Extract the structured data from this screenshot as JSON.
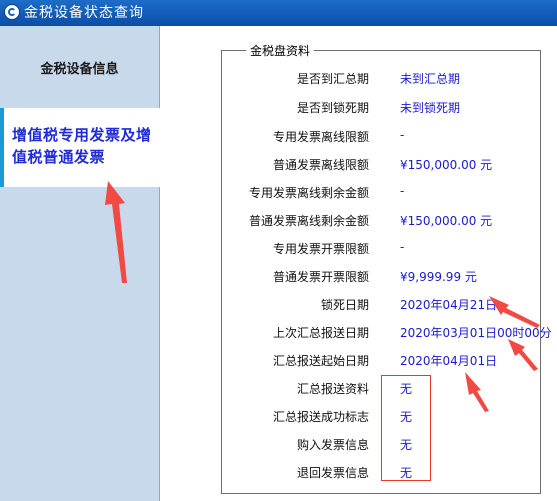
{
  "window": {
    "title": "金税设备状态查询",
    "icon": "golden-tax-app-icon"
  },
  "sidebar": {
    "tabs": [
      {
        "label": "金税设备信息"
      },
      {
        "label_line1": "增值税专用发票及增",
        "label_line2": "值税普通发票"
      }
    ]
  },
  "group": {
    "legend": "金税盘资料",
    "rows": [
      {
        "label": "是否到汇总期",
        "value": "未到汇总期"
      },
      {
        "label": "是否到锁死期",
        "value": "未到锁死期"
      },
      {
        "label": "专用发票离线限额",
        "value": "-"
      },
      {
        "label": "普通发票离线限额",
        "value": "¥150,000.00 元"
      },
      {
        "label": "专用发票离线剩余金额",
        "value": "-"
      },
      {
        "label": "普通发票离线剩余金额",
        "value": "¥150,000.00 元"
      },
      {
        "label": "专用发票开票限额",
        "value": "-"
      },
      {
        "label": "普通发票开票限额",
        "value": "¥9,999.99 元"
      },
      {
        "label": "锁死日期",
        "value": "2020年04月21日"
      },
      {
        "label": "上次汇总报送日期",
        "value": "2020年03月01日00时00分"
      },
      {
        "label": "汇总报送起始日期",
        "value": "2020年04月01日"
      },
      {
        "label": "汇总报送资料",
        "value": "无"
      },
      {
        "label": "汇总报送成功标志",
        "value": "无"
      },
      {
        "label": "购入发票信息",
        "value": "无"
      },
      {
        "label": "退回发票信息",
        "value": "无"
      }
    ]
  },
  "annotations": {
    "arrow_color": "#f04a43",
    "box_color": "#e8392b"
  }
}
